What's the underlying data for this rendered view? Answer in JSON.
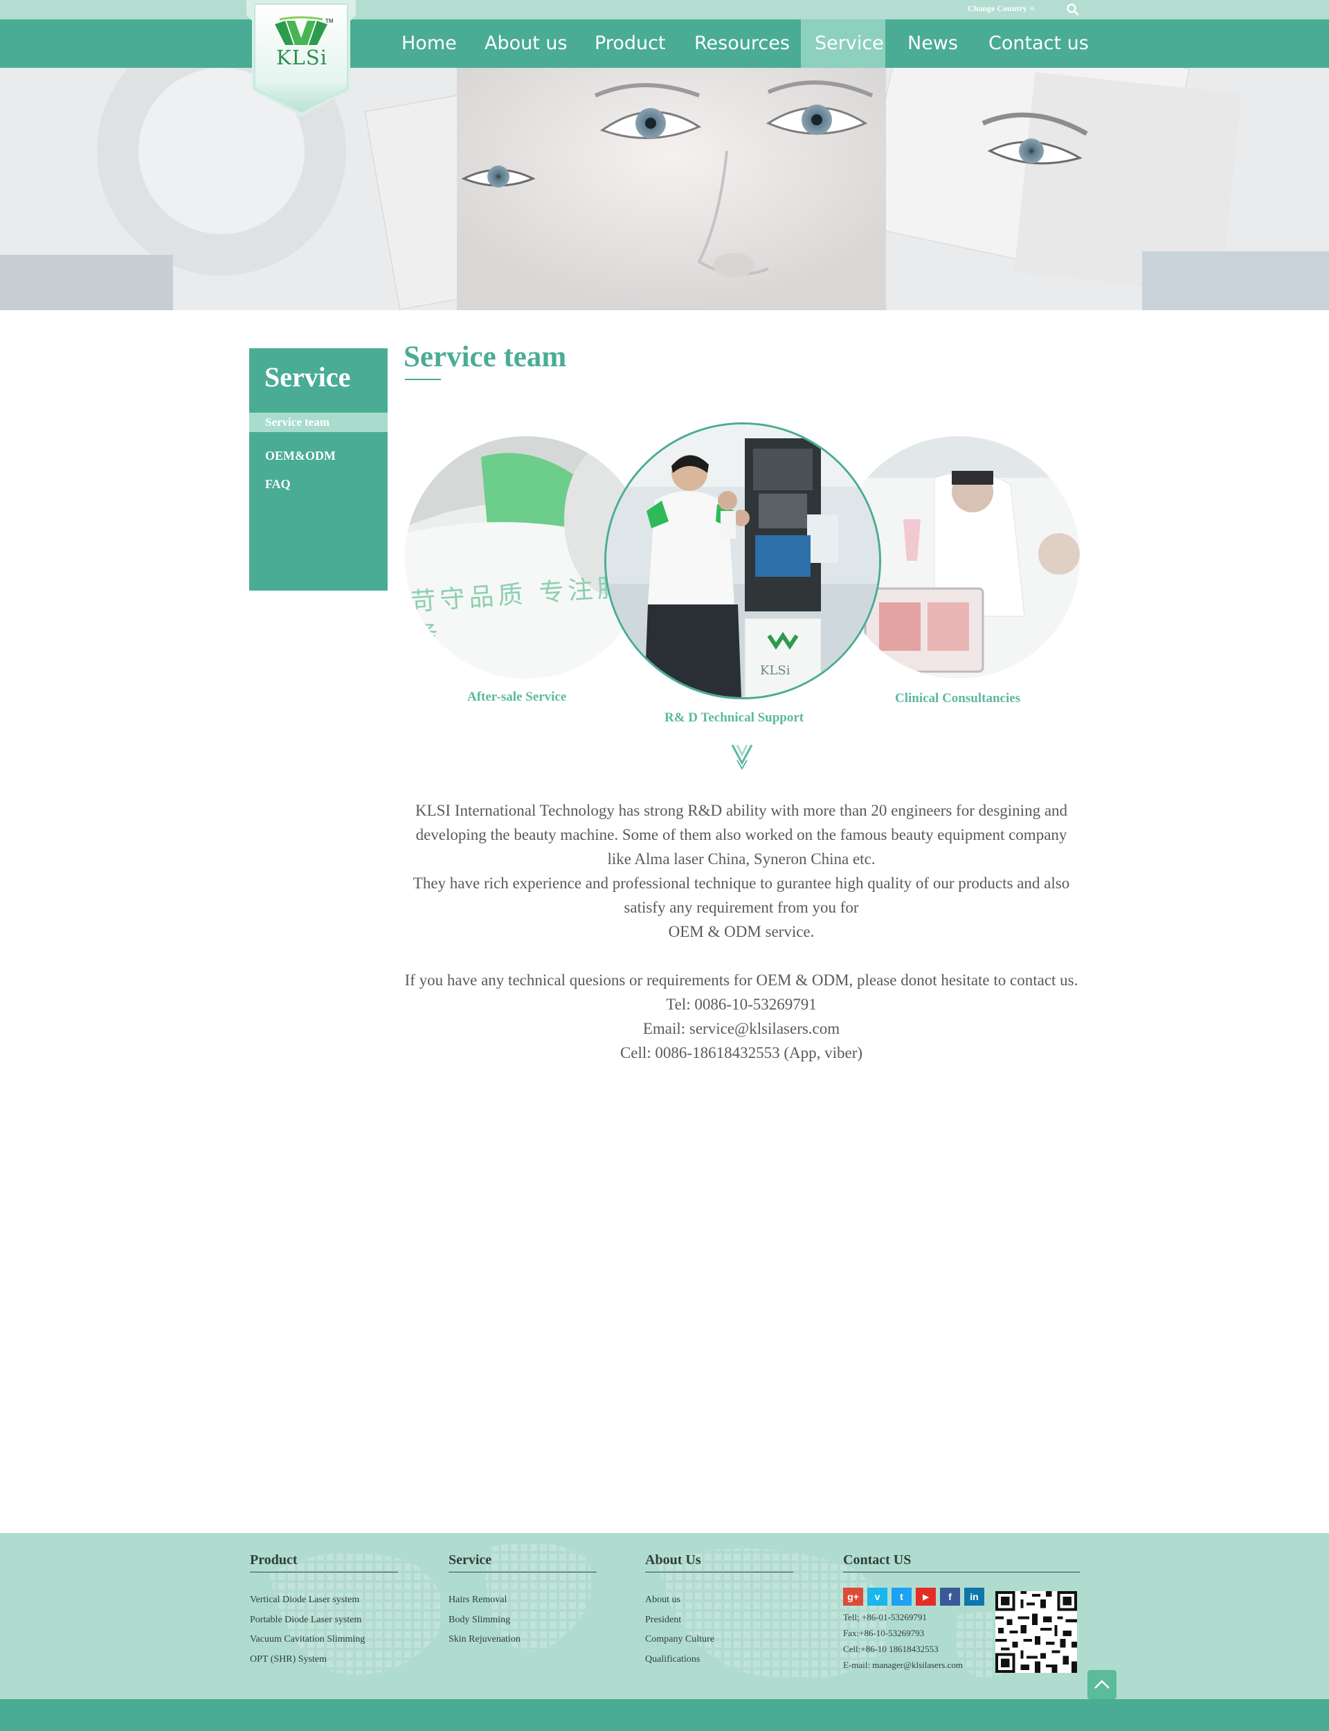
{
  "topbar": {
    "change_country": "Change Country",
    "menu_glyph": "≡"
  },
  "logo": {
    "text": "KLSi",
    "tm": "TM"
  },
  "nav": {
    "items": [
      {
        "label": "Home"
      },
      {
        "label": "About us"
      },
      {
        "label": "Product"
      },
      {
        "label": "Resources"
      },
      {
        "label": "Service",
        "active": true
      },
      {
        "label": "News"
      },
      {
        "label": "Contact us"
      }
    ]
  },
  "sidebar": {
    "title": "Service",
    "items": [
      {
        "label": "Service team",
        "active": true
      },
      {
        "label": "OEM&ODM"
      },
      {
        "label": "FAQ"
      }
    ]
  },
  "main": {
    "title": "Service team",
    "circles": [
      {
        "label": "After-sale Service",
        "photo_text": "苛守品质 专注服务"
      },
      {
        "label": "R& D Technical Support",
        "photo_text": "KLSi"
      },
      {
        "label": "Clinical Consultancies"
      }
    ],
    "paragraphs": [
      "KLSI International Technology has strong R&D ability  with more than 20 engineers for desgining and developing the beauty machine.  Some of them also worked on the famous beauty equipment company like Alma laser China, Syneron China etc.",
      "They have rich experience and professional technique to gurantee high quality of our products and also satisfy any requirement from you for",
      "OEM & ODM service.",
      "",
      "If you have any technical quesions or requirements for OEM & ODM,  please donot hesitate to contact us.",
      "Tel: 0086-10-53269791",
      "Email: service@klsilasers.com",
      "Cell: 0086-18618432553 (App, viber)"
    ]
  },
  "footer": {
    "product": {
      "title": "Product",
      "links": [
        "Vertical Diode Laser system",
        "Portable Diode Laser system",
        "Vacuum Cavitation Slimming",
        "OPT (SHR) System"
      ]
    },
    "service": {
      "title": "Service",
      "links": [
        "Hairs Removal",
        "Body Slimming",
        "Skin Rejuvenation"
      ]
    },
    "about": {
      "title": "About Us",
      "links": [
        "About us",
        "President",
        "Company Culture",
        "Qualifications"
      ]
    },
    "contact": {
      "title": "Contact US",
      "social": [
        {
          "icon": "google-plus-icon",
          "glyph": "g+",
          "color": "#dd4b39"
        },
        {
          "icon": "vimeo-icon",
          "glyph": "v",
          "color": "#1ab7ea"
        },
        {
          "icon": "twitter-icon",
          "glyph": "t",
          "color": "#1da1f2"
        },
        {
          "icon": "youtube-icon",
          "glyph": "▶",
          "color": "#e52d27"
        },
        {
          "icon": "facebook-icon",
          "glyph": "f",
          "color": "#3b5998"
        },
        {
          "icon": "linkedin-icon",
          "glyph": "in",
          "color": "#0e76a8"
        }
      ],
      "lines": [
        "Tell; +86-01-53269791",
        "Fax:+86-10-53269793",
        "Cell:+86-10 18618432553",
        "E-mail: manager@klsilasers.com"
      ]
    }
  },
  "colors": {
    "primary": "#4aac94",
    "topbar": "#b2ddd0",
    "active_nav": "#8cd0bd",
    "footer": "#b0dccf",
    "label": "#5cb8a1"
  }
}
